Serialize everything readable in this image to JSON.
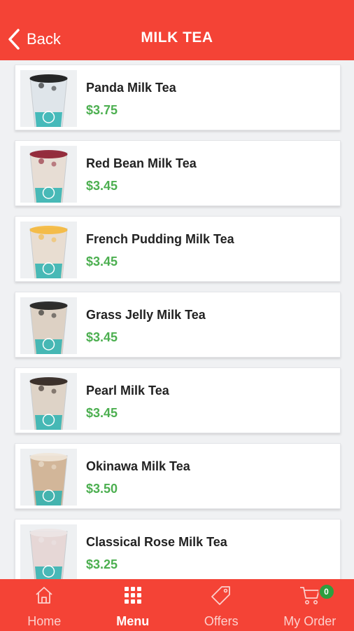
{
  "header": {
    "back_label": "Back",
    "title": "MILK TEA"
  },
  "items": [
    {
      "name": "Panda Milk Tea",
      "price": "$3.75",
      "topping": "#111111",
      "tea": "#dfe5ea"
    },
    {
      "name": "Red Bean Milk Tea",
      "price": "$3.45",
      "topping": "#8b1a2b",
      "tea": "#e7ddd4"
    },
    {
      "name": "French Pudding Milk Tea",
      "price": "$3.45",
      "topping": "#f5b83a",
      "tea": "#e8ddd1"
    },
    {
      "name": "Grass Jelly Milk Tea",
      "price": "$3.45",
      "topping": "#1a1a1a",
      "tea": "#ddd1c4"
    },
    {
      "name": "Pearl Milk Tea",
      "price": "$3.45",
      "topping": "#2a1f1a",
      "tea": "#ded3c7"
    },
    {
      "name": "Okinawa Milk Tea",
      "price": "$3.50",
      "topping": "#efe6d8",
      "tea": "#d2b699"
    },
    {
      "name": "Classical Rose Milk Tea",
      "price": "$3.25",
      "topping": "#ece6e6",
      "tea": "#e6d7d6"
    }
  ],
  "tabs": [
    {
      "label": "Home",
      "icon": "home-icon"
    },
    {
      "label": "Menu",
      "icon": "grid-icon"
    },
    {
      "label": "Offers",
      "icon": "tag-icon"
    },
    {
      "label": "My Order",
      "icon": "cart-icon",
      "badge": "0"
    }
  ],
  "colors": {
    "primary": "#f44336",
    "price": "#4caf50",
    "badge": "#2e9e3f",
    "cup_logo": "#2bb3b1"
  }
}
